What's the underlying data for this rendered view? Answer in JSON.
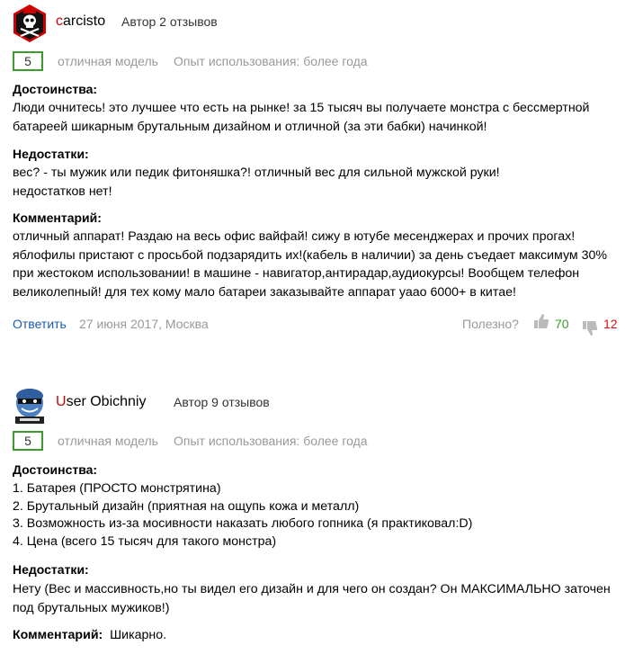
{
  "reviews": [
    {
      "author_first": "c",
      "author_rest": "arcisto",
      "author_count": "Автор 2 отзывов",
      "grade": "5",
      "grade_text": "отличная модель",
      "experience": "Опыт использования: более года",
      "pros_label": "Достоинства:",
      "pros_lines": [
        "Люди очнитесь! это лучшее что есть на рынке! за 15 тысяч вы получаете монстра с бессмертной",
        "батареей шикарным брутальным дизайном и отличной (за эти бабки) начинкой!"
      ],
      "cons_label": "Недостатки:",
      "cons_lines": [
        "вес? - ты мужик или педик фитоняшка?! отличный вес для сильной мужской руки!",
        "недостатков нет!"
      ],
      "comment_label": "Комментарий:",
      "comment_lines": [
        "отличный аппарат! Раздаю на весь офис вайфай! сижу в ютубе месенджерах и прочих прогах!",
        "яблофилы пристают с просьбой подзарядить их!(кабель в наличии) за день съедает максимум 30%",
        "при жестоком использовании! в машине - навигатор,антирадар,аудиокурсы! Вообщем телефон",
        "великолепный! для тех кому мало батареи заказывайте аппарат уаао 6000+ в китае!"
      ],
      "reply": "Ответить",
      "date": "27 июня 2017, Москва",
      "useful": "Полезно?",
      "likes": "70",
      "dislikes": "12"
    },
    {
      "author_first": "U",
      "author_rest": "ser Obichniy",
      "author_count": "Автор 9 отзывов",
      "grade": "5",
      "grade_text": "отличная модель",
      "experience": "Опыт использования: более года",
      "pros_label": "Достоинства:",
      "pros_lines": [
        "1. Батарея (ПРОСТО монстрятина)",
        "2. Брутальный дизайн (приятная на ощупь кожа и металл)",
        "3. Возможность из-за мосивности наказать любого гопника (я практиковал:D)",
        "4. Цена (всего 15 тысяч для такого монстра)"
      ],
      "cons_label": "Недостатки:",
      "cons_lines": [
        "Нету (Вес и массивность,но ты видел его дизайн и для чего он создан? Он МАКСИМАЛЬНО заточен",
        "под брутальных мужиков!)"
      ],
      "comment_label": "Комментарий:",
      "comment_text": "Шикарно."
    }
  ],
  "colors": {
    "author_initial": "#cc0000",
    "grade_border": "#3a9c2d",
    "link": "#1a5bb0",
    "muted": "#999999",
    "likes": "#3a9c2d",
    "dislikes": "#dd1111"
  },
  "icons": {
    "avatar1": "skull-crossbones-avatar",
    "avatar2": "masked-character-avatar",
    "like": "thumbs-up-icon",
    "dislike": "thumbs-down-icon"
  }
}
